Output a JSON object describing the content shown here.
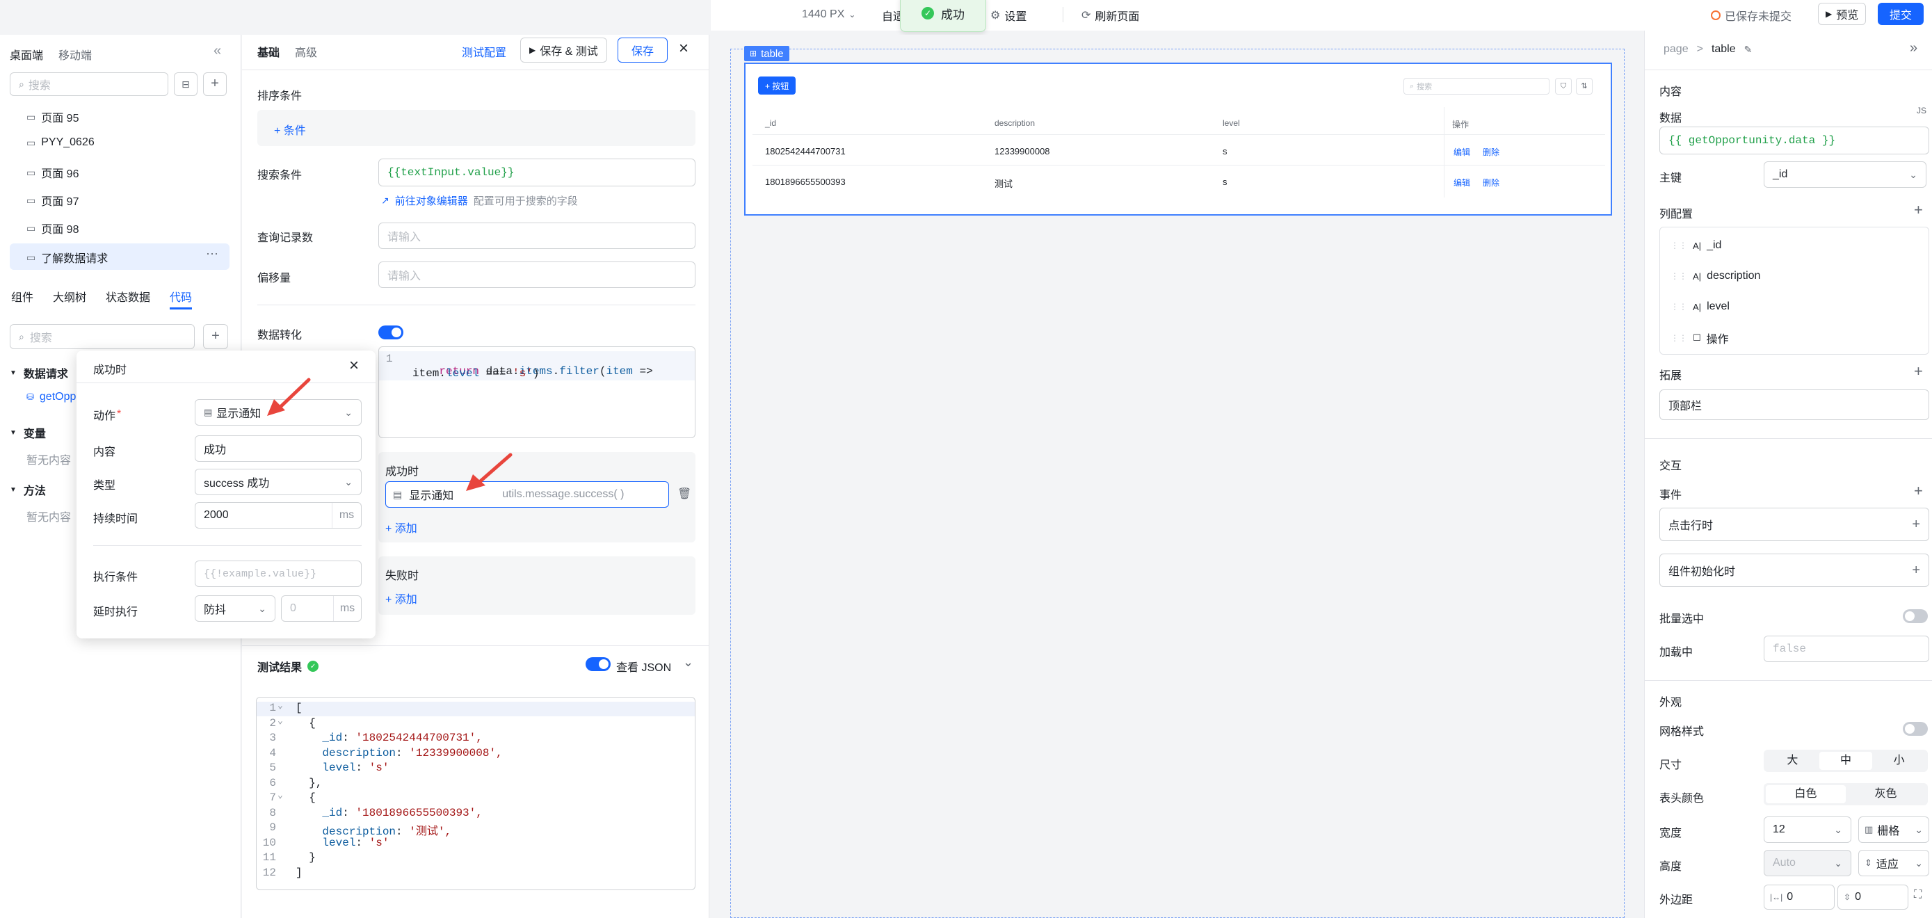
{
  "topbar": {
    "width_label": "1440 PX",
    "auto_label": "自适",
    "settings_label": "设置",
    "refresh_label": "刷新页面",
    "saved_status": "已保存未提交",
    "preview_label": "预览",
    "submit_label": "提交"
  },
  "toast": {
    "text": "成功"
  },
  "left": {
    "tabs": [
      "桌面端",
      "移动端"
    ],
    "search_placeholder": "搜索",
    "pages": [
      "页面 95",
      "PYY_0626",
      "页面 96",
      "页面 97",
      "页面 98",
      "了解数据请求"
    ],
    "bottom_tabs": [
      "组件",
      "大纲树",
      "状态数据",
      "代码"
    ],
    "search2_placeholder": "搜索",
    "groups": {
      "data_request": "数据请求",
      "data_item": "getOpp",
      "variables": "变量",
      "variables_empty": "暂无内容",
      "methods": "方法",
      "methods_empty": "暂无内容"
    }
  },
  "popup": {
    "title": "成功时",
    "action_label": "动作",
    "action_value": "显示通知",
    "content_label": "内容",
    "content_value": "成功",
    "type_label": "类型",
    "type_value": "success 成功",
    "duration_label": "持续时间",
    "duration_value": "2000",
    "duration_unit": "ms",
    "condition_label": "执行条件",
    "condition_placeholder": "{{!example.value}}",
    "delay_label": "延时执行",
    "delay_mode": "防抖",
    "delay_value": "0",
    "delay_unit": "ms"
  },
  "config": {
    "tabs": [
      "基础",
      "高级"
    ],
    "test_config": "测试配置",
    "save_test": "保存 & 测试",
    "save": "保存",
    "sort_label": "排序条件",
    "add_condition": "+ 条件",
    "search_label": "搜索条件",
    "search_value": "{{textInput.value}}",
    "object_editor_link": "前往对象编辑器",
    "object_editor_hint": "配置可用于搜索的字段",
    "query_count_label": "查询记录数",
    "query_count_placeholder": "请输入",
    "offset_label": "偏移量",
    "offset_placeholder": "请输入",
    "transform_label": "数据转化",
    "transform_code_line1": "return data.items.filter(item =>",
    "transform_code_line2": "item.level === 's')",
    "on_success_label": "成功时",
    "on_success_action": "显示通知",
    "on_success_code": "utils.message.success( )",
    "add_label": "+ 添加",
    "on_fail_label": "失败时",
    "add_label2": "+ 添加",
    "result_label": "测试结果",
    "view_json_label": "查看 JSON",
    "json_lines": [
      "[",
      "  {",
      "    _id: '1802542444700731',",
      "    description: '12339900008',",
      "    level: 's'",
      "  },",
      "  {",
      "    _id: '1801896655500393',",
      "    description: '测试',",
      "    level: 's'",
      "  }",
      "]"
    ]
  },
  "canvas": {
    "table_tag": "table",
    "add_button": "+ 按钮",
    "search_placeholder": "搜索",
    "columns": [
      "_id",
      "description",
      "level",
      "操作"
    ],
    "rows": [
      {
        "id": "1802542444700731",
        "description": "12339900008",
        "level": "s",
        "edit": "编辑",
        "delete": "删除"
      },
      {
        "id": "1801896655500393",
        "description": "测试",
        "level": "s",
        "edit": "编辑",
        "delete": "删除"
      }
    ]
  },
  "right": {
    "breadcrumb_page": "page",
    "breadcrumb_sep": ">",
    "breadcrumb_current": "table",
    "content_title": "内容",
    "data_label": "数据",
    "js_badge": "JS",
    "data_value": "{{ getOpportunity.data }}",
    "key_label": "主键",
    "key_value": "_id",
    "columns_label": "列配置",
    "columns": [
      "_id",
      "description",
      "level",
      "操作"
    ],
    "extend_label": "拓展",
    "extend_value": "顶部栏",
    "interaction_title": "交互",
    "events_label": "事件",
    "event_row_click": "点击行时",
    "event_init": "组件初始化时",
    "batch_select_label": "批量选中",
    "loading_label": "加载中",
    "loading_value": "false",
    "appearance_title": "外观",
    "grid_style_label": "网格样式",
    "size_label": "尺寸",
    "size_options": [
      "大",
      "中",
      "小"
    ],
    "header_color_label": "表头颜色",
    "header_color_options": [
      "白色",
      "灰色"
    ],
    "width_label": "宽度",
    "width_value": "12",
    "width_unit": "栅格",
    "height_label": "高度",
    "height_value": "Auto",
    "height_unit": "适应",
    "margin_label": "外边距",
    "margin_h": "0",
    "margin_v": "0"
  }
}
